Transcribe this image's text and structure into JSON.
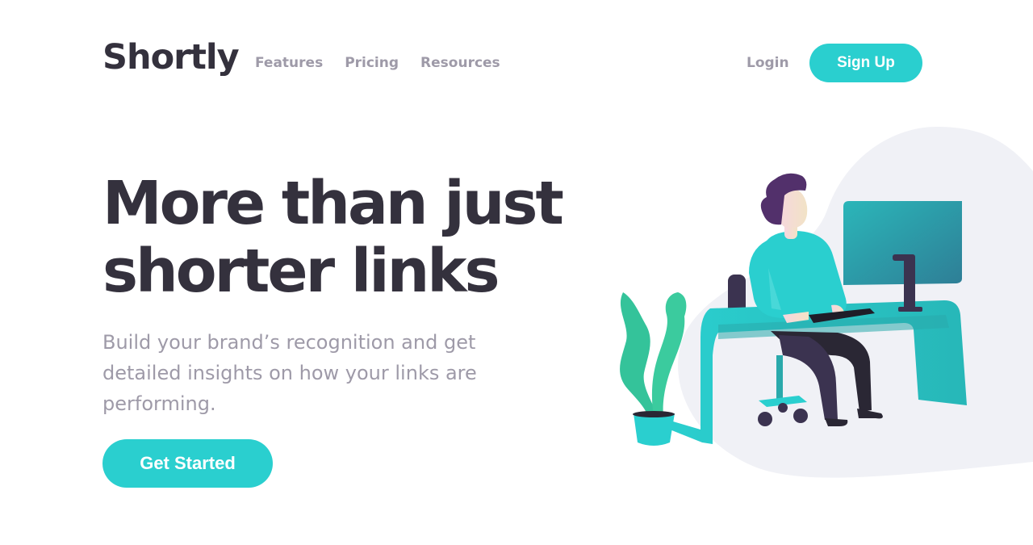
{
  "header": {
    "logo": "Shortly",
    "nav": [
      {
        "label": "Features"
      },
      {
        "label": "Pricing"
      },
      {
        "label": "Resources"
      }
    ],
    "login_label": "Login",
    "signup_label": "Sign Up"
  },
  "hero": {
    "title_line1": "More than just",
    "title_line2": "shorter links",
    "subtitle": "Build your brand’s recognition and get detailed insights on how your links are performing.",
    "cta_label": "Get Started"
  },
  "colors": {
    "accent": "#2acfcf",
    "heading": "#34313d",
    "muted": "#9e9aa8",
    "blob": "#f0f1f6"
  },
  "illustration": {
    "name": "person-working-at-desk-illustration"
  }
}
